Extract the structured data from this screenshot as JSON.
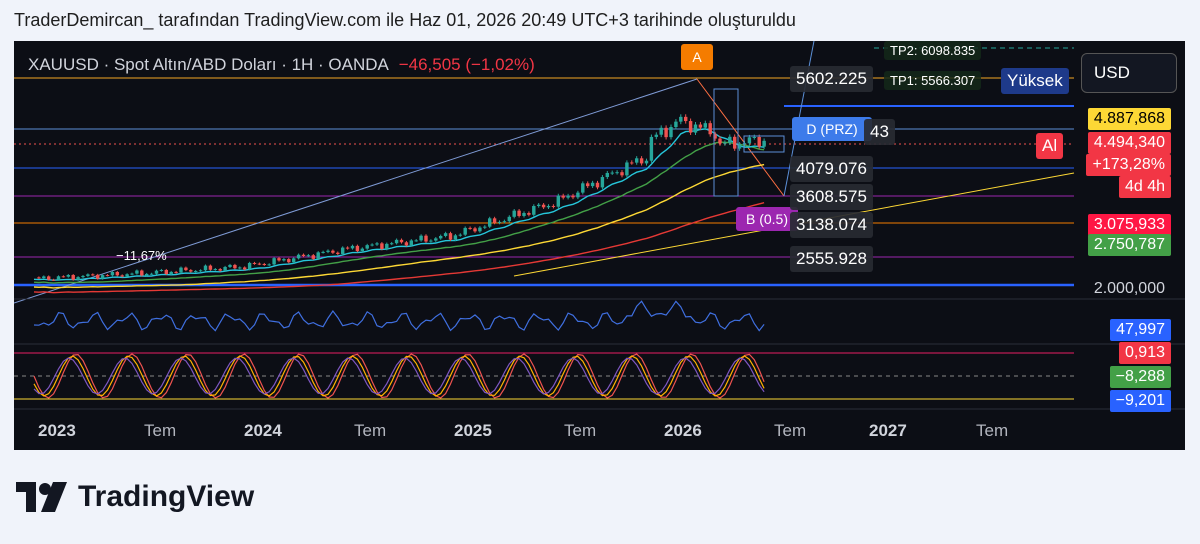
{
  "header": {
    "text": "TraderDemircan_ tarafından TradingView.com ile Haz 01, 2026 20:49 UTC+3 tarihinde oluşturuldu"
  },
  "symbol": {
    "text": "XAUUSD · Spot Altın/ABD Doları · 1H · OANDA",
    "change": "−46,505 (−1,02%)"
  },
  "currency_button": "USD",
  "markers": {
    "a": "A",
    "d_prz": "D (PRZ)",
    "b": "B (0.5)",
    "pct": "−11,67%"
  },
  "levels": [
    "5602.225",
    "43",
    "4079.076",
    "3608.575",
    "3138.074",
    "2555.928"
  ],
  "tp_labels": {
    "tp2": "TP2: 6098.835",
    "tp1": "TP1: 5566.307",
    "high": "Yüksek"
  },
  "right_tags": {
    "t1": "4.887,868",
    "t2": "4.494,340",
    "t2b": "+173,28%",
    "t2c": "4d 4h",
    "t3": "3.075,933",
    "t4": "2.750,787",
    "t5": "2.000,000",
    "t6": "47,997",
    "t7": "0,913",
    "t8": "−8,288",
    "t9": "−9,201",
    "al": "Al"
  },
  "x_axis": [
    "2023",
    "Tem",
    "2024",
    "Tem",
    "2025",
    "Tem",
    "2026",
    "Tem",
    "2027",
    "Tem"
  ],
  "colors": {
    "bg": "#0c0e15",
    "up": "#26a69a",
    "down": "#ef5350",
    "accent_orange": "#f57c00",
    "purple": "#9c27b0"
  },
  "logo": "TradingView",
  "chart_data": {
    "type": "line",
    "title": "XAUUSD · Spot Altın/ABD Doları · 1H · OANDA",
    "x": [
      "2023",
      "Tem",
      "2024",
      "Tem",
      "2025",
      "Tem",
      "2026",
      "Tem",
      "2027",
      "Tem"
    ],
    "series": [
      {
        "name": "XAUUSD",
        "values": [
          1830,
          1930,
          2060,
          2400,
          2650,
          3300,
          4300,
          4490
        ]
      }
    ],
    "ylim": [
      1500,
      6200
    ]
  }
}
